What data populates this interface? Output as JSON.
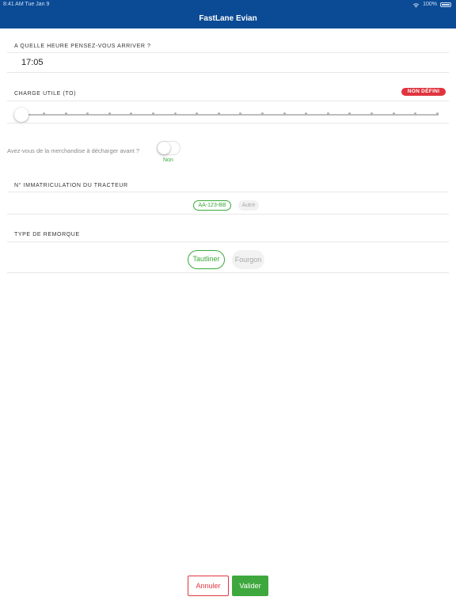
{
  "status_bar": {
    "time_date": "8:41 AM   Tue Jan 9",
    "battery": "100%"
  },
  "header": {
    "title": "FastLane Evian"
  },
  "arrival": {
    "label": "A QUELLE HEURE PENSEZ-VOUS ARRIVER ?",
    "value": "17:05"
  },
  "payload": {
    "label": "CHARGE UTILE (TO)",
    "badge": "NON DÉFINI",
    "slider_value_fraction": 0
  },
  "unload": {
    "question": "Avez-vous de la merchandise à décharger avant ?",
    "toggle_on": false,
    "caption": "Non"
  },
  "tractor": {
    "label": "N° IMMATRICULATION DU TRACTEUR",
    "options": [
      "AA-123-BB",
      "Autre"
    ],
    "selected": "AA-123-BB"
  },
  "trailer": {
    "label": "TYPE DE REMORQUE",
    "options": [
      "Tautliner",
      "Fourgon"
    ],
    "selected": "Tautliner"
  },
  "actions": {
    "cancel_label": "Annuler",
    "confirm_label": "Valider"
  },
  "colors": {
    "brand": "#0b4a94",
    "accent_green": "#3aa93a",
    "alert_red": "#e0353f"
  }
}
